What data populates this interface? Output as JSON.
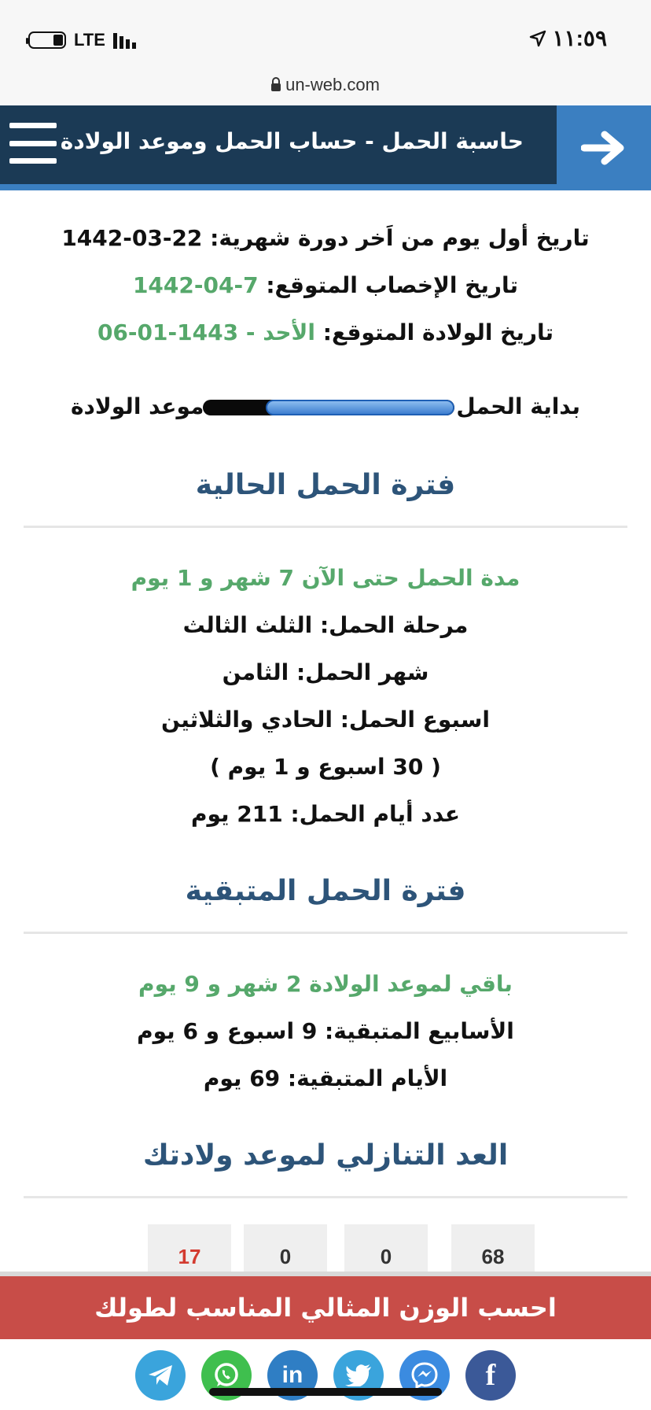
{
  "status_bar": {
    "network": "LTE",
    "time": "١١:٥٩"
  },
  "browser": {
    "url": "un-web.com"
  },
  "header": {
    "title": "حاسبة الحمل - حساب الحمل وموعد الولادة"
  },
  "dates": {
    "last_period_label": "تاريخ أول يوم من اَخر دورة شهرية:",
    "last_period_value": "1442-03-22",
    "ovulation_label": "تاريخ الإخصاب المتوقع:",
    "ovulation_value": "1442-04-7",
    "birth_label": "تاريخ الولادة المتوقع:",
    "birth_value": "الأحد - 1443-01-06"
  },
  "progress": {
    "start_label": "بداية الحمل",
    "end_label": "موعد الولادة",
    "fraction": 0.75
  },
  "current_period": {
    "title": "فترة الحمل الحالية",
    "duration": "مدة الحمل حتى الآن 7 شهر و 1 يوم",
    "stage": "مرحلة الحمل: الثلث الثالث",
    "month": "شهر الحمل: الثامن",
    "week": "اسبوع الحمل: الحادي والثلاثين",
    "weeks_days": "( 30 اسبوع و 1 يوم )",
    "days_count": "عدد أيام الحمل: 211 يوم"
  },
  "remaining_period": {
    "title": "فترة الحمل المتبقية",
    "remaining": "باقي لموعد الولادة 2 شهر و 9 يوم",
    "weeks": "الأسابيع المتبقية: 9 اسبوع و 6 يوم",
    "days": "الأيام المتبقية: 69 يوم"
  },
  "countdown": {
    "title": "العد التنازلي لموعد ولادتك",
    "values": [
      "68",
      "0",
      "0",
      "17"
    ]
  },
  "banner": {
    "text": "احسب الوزن المثالي المناسب لطولك"
  },
  "share": {
    "icons": [
      "telegram-icon",
      "whatsapp-icon",
      "linkedin-icon",
      "twitter-icon",
      "messenger-icon",
      "facebook-icon"
    ],
    "colors": [
      "#3aa4dc",
      "#3fbf4e",
      "#2f7ec4",
      "#3aa4dc",
      "#3b8be0",
      "#3b5998"
    ]
  },
  "colors": {
    "header_bg": "#1b3a55",
    "accent_blue": "#3b7fc1",
    "green_text": "#56a86b",
    "section_title": "#2d5479",
    "banner_bg": "#c84d48"
  }
}
